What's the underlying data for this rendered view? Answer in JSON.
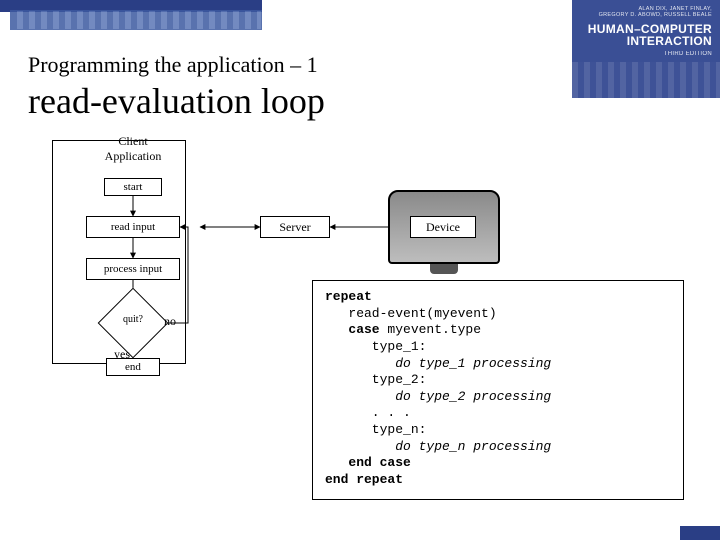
{
  "book": {
    "authors": "ALAN DIX, JANET FINLAY,\nGREGORY D. ABOWD, RUSSELL BEALE",
    "title": "HUMAN–COMPUTER\nINTERACTION",
    "edition": "THIRD EDITION"
  },
  "heading": {
    "super": "Programming the application – 1",
    "main": "read-evaluation loop"
  },
  "flow": {
    "client_title": "Client\nApplication",
    "start": "start",
    "read_input": "read input",
    "process_input": "process input",
    "decision": "quit?",
    "no": "no",
    "yes": "yes",
    "end": "end",
    "server": "Server",
    "device": "Device"
  },
  "code": {
    "kw_repeat": "repeat",
    "fn_read": "   read-event(myevent)",
    "kw_case": "   case",
    "case_expr": " myevent.type",
    "t1": "      type_1:",
    "t1do": "         do type_1 processing",
    "t2": "      type_2:",
    "t2do": "         do type_2 processing",
    "dots": "      . . .",
    "tn": "      type_n:",
    "tndo": "         do type_n processing",
    "kw_endcase": "   end case",
    "kw_endrepeat": "end repeat"
  }
}
